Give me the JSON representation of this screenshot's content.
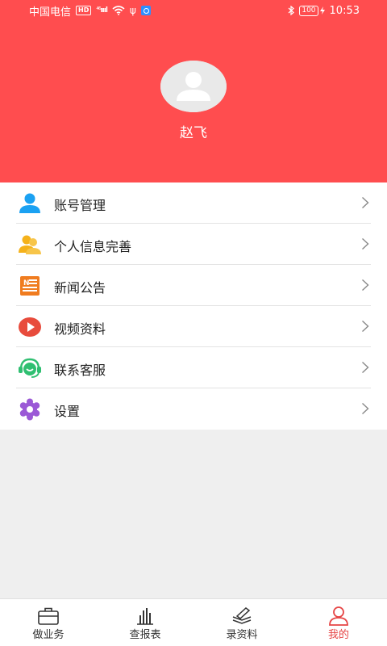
{
  "status_bar": {
    "carrier": "中国电信",
    "hd_badge": "HD",
    "signal_label": "⁴⁶",
    "signal_bars": "ıııl",
    "usb_symbol": "ψ",
    "battery_level": "100",
    "time": "10:53"
  },
  "profile": {
    "name": "赵飞"
  },
  "menu": {
    "items": [
      {
        "label": "账号管理",
        "icon": "person-icon",
        "color": "#1ba1f2"
      },
      {
        "label": "个人信息完善",
        "icon": "users-icon",
        "color": "#f5b21b"
      },
      {
        "label": "新闻公告",
        "icon": "news-icon",
        "color": "#f07c1f"
      },
      {
        "label": "视频资料",
        "icon": "video-play-icon",
        "color": "#e84b3c"
      },
      {
        "label": "联系客服",
        "icon": "customer-service-icon",
        "color": "#2fbf71"
      },
      {
        "label": "设置",
        "icon": "settings-gear-icon",
        "color": "#9b59d6"
      }
    ]
  },
  "bottom_nav": {
    "items": [
      {
        "label": "做业务",
        "icon": "briefcase-icon",
        "active": false
      },
      {
        "label": "查报表",
        "icon": "bar-chart-icon",
        "active": false
      },
      {
        "label": "录资料",
        "icon": "document-pen-icon",
        "active": false
      },
      {
        "label": "我的",
        "icon": "profile-icon",
        "active": true
      }
    ]
  },
  "colors": {
    "header_bg": "#ff4d4f",
    "active_tab": "#e64545"
  }
}
